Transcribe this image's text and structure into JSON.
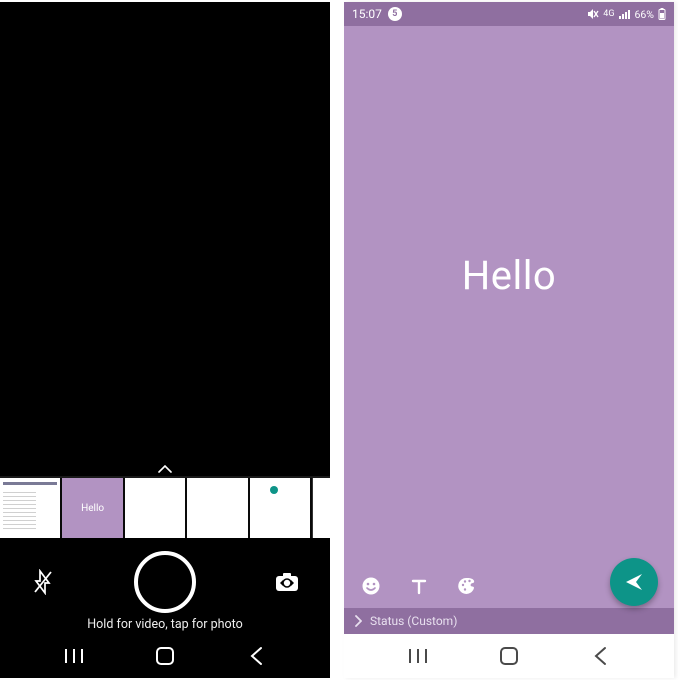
{
  "left": {
    "thumbs": {
      "hello_label": "Hello"
    },
    "hint": "Hold for video, tap for photo"
  },
  "right": {
    "statusbar": {
      "time": "15:07",
      "notif_badge": "5",
      "network": "4G",
      "battery_pct": "66%"
    },
    "compose_text": "Hello",
    "recipient_label": "Status (Custom)"
  },
  "colors": {
    "status_bg": "#b293c2",
    "header_bg": "#8f6fa0",
    "send_fab": "#0d9488"
  }
}
